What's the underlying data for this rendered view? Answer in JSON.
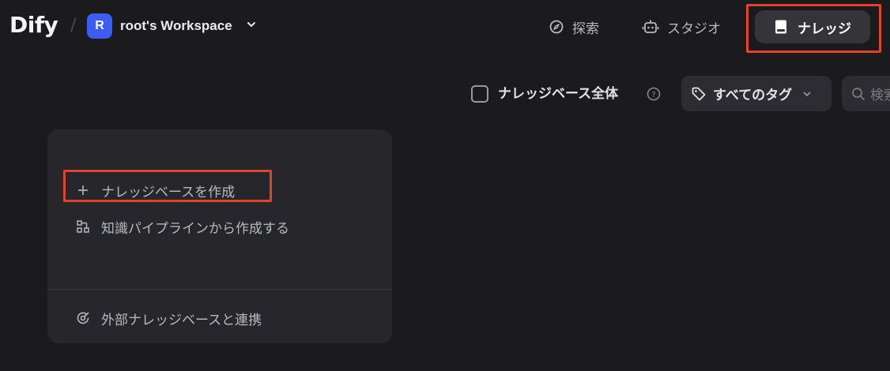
{
  "header": {
    "logo": "Dify",
    "separator": "/",
    "workspace": {
      "avatar_letter": "R",
      "name": "root's Workspace"
    },
    "nav": {
      "explore": "探索",
      "studio": "スタジオ",
      "knowledge": "ナレッジ"
    }
  },
  "filters": {
    "all_kb_label": "ナレッジベース全体",
    "tags_label": "すべてのタグ",
    "search_placeholder": "検索"
  },
  "card": {
    "create_kb": "ナレッジベースを作成",
    "create_from_pipeline": "知識パイプラインから作成する",
    "connect_external": "外部ナレッジベースと連携"
  },
  "colors": {
    "background": "#1b1b1d",
    "card": "#27272b",
    "highlight": "#e1442a",
    "workspace_avatar": "#3d5cf5"
  }
}
